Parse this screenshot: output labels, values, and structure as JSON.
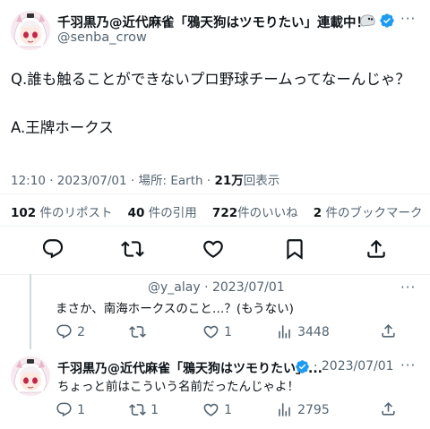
{
  "main_tweet": {
    "author_name": "千羽黒乃@近代麻雀「鴉天狗はツモりたい」連載中！",
    "handle": "@senba_crow",
    "text_line1": "Q.誰も触ることができないプロ野球チームってなーんじゃ？",
    "text_line2": "A.王牌ホークス",
    "time": "12:10",
    "date": "2023/07/01",
    "location_label": "場所: Earth",
    "views_value": "21万",
    "views_label": "回表示",
    "separator": "·"
  },
  "stats": {
    "retweets_count": "102",
    "retweets_label": "件のリポスト",
    "quotes_count": "40",
    "quotes_label": "件の引用",
    "likes_count": "722",
    "likes_label": "件のいいね",
    "bookmarks_count": "2",
    "bookmarks_label": "件のブックマーク"
  },
  "reply1": {
    "handle_date": "@y_alay · 2023/07/01",
    "text": "まさか、南海ホークスのこと…？(もうない)",
    "replies": "2",
    "retweets": "",
    "likes": "1",
    "views": "3448"
  },
  "reply2": {
    "author_name": "千羽黒乃@近代麻雀「鴉天狗はツモりたい」...",
    "date": "· 2023/07/01",
    "text": "ちょっと前はこういう名前だったんじゃよ！",
    "replies": "1",
    "retweets": "1",
    "likes": "1",
    "views": "2795"
  },
  "colors": {
    "verified": "#1d9bf0",
    "secondary": "#536471",
    "divider": "#eff3f4"
  }
}
